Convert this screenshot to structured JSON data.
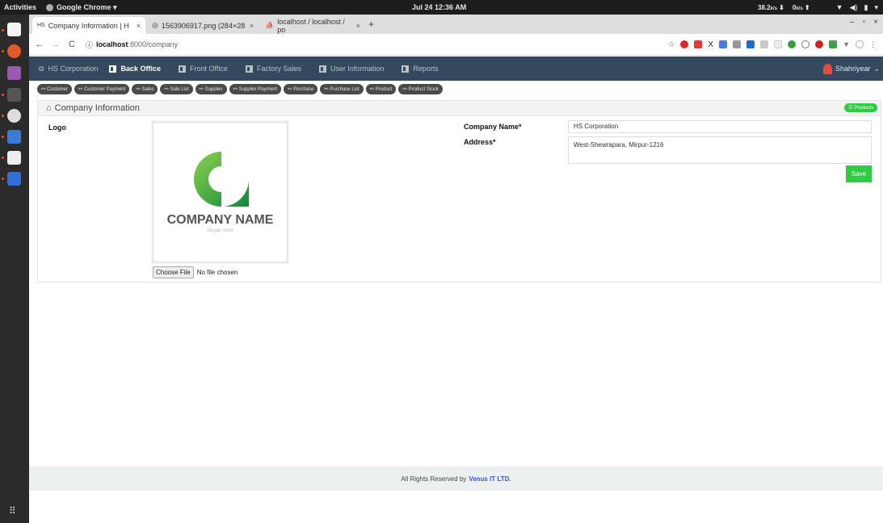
{
  "system": {
    "activities": "Activities",
    "app_name": "Google Chrome ▾",
    "clock": "Jul 24 12:36 AM",
    "net_down": "38.2",
    "net_down_unit": "k/s",
    "net_up": "0",
    "net_up_unit": "k/s"
  },
  "browser": {
    "tabs": [
      {
        "title": "Company Information | H"
      },
      {
        "title": "1563906917.png (284×28"
      },
      {
        "title": "localhost / localhost / po"
      }
    ],
    "url_host": "localhost",
    "url_path": ":8000/company"
  },
  "navbar": {
    "brand": "HS Corporation",
    "items": [
      "Back Office",
      "Front Office",
      "Factory Sales",
      "User Information",
      "Reports"
    ],
    "user": "Shahriyear"
  },
  "quick_links": [
    "Customer",
    "Customer Payment",
    "Sales",
    "Sale List",
    "Supplier",
    "Supplier Payment",
    "Purchase",
    "Purchase List",
    "Product",
    "Product Stock"
  ],
  "panel": {
    "title": "Company Information",
    "products_button": "Products",
    "logo_label": "Logo",
    "logo_text": "COMPANY NAME",
    "logo_slogan": "Slogan Here",
    "choose_file": "Choose File",
    "no_file": "No file chosen",
    "company_name_label": "Company Name*",
    "company_name_value": "HS Corporation",
    "address_label": "Address*",
    "address_value": "West-Shewrapara, Mirpur-1216",
    "save": "Save"
  },
  "footer": {
    "text": "All Rights Reserved by",
    "company": "Venus IT LTD."
  },
  "colors": {
    "navbar": "#34495e",
    "accent_green": "#2ecc40",
    "logo_green": "#1fa33a"
  }
}
